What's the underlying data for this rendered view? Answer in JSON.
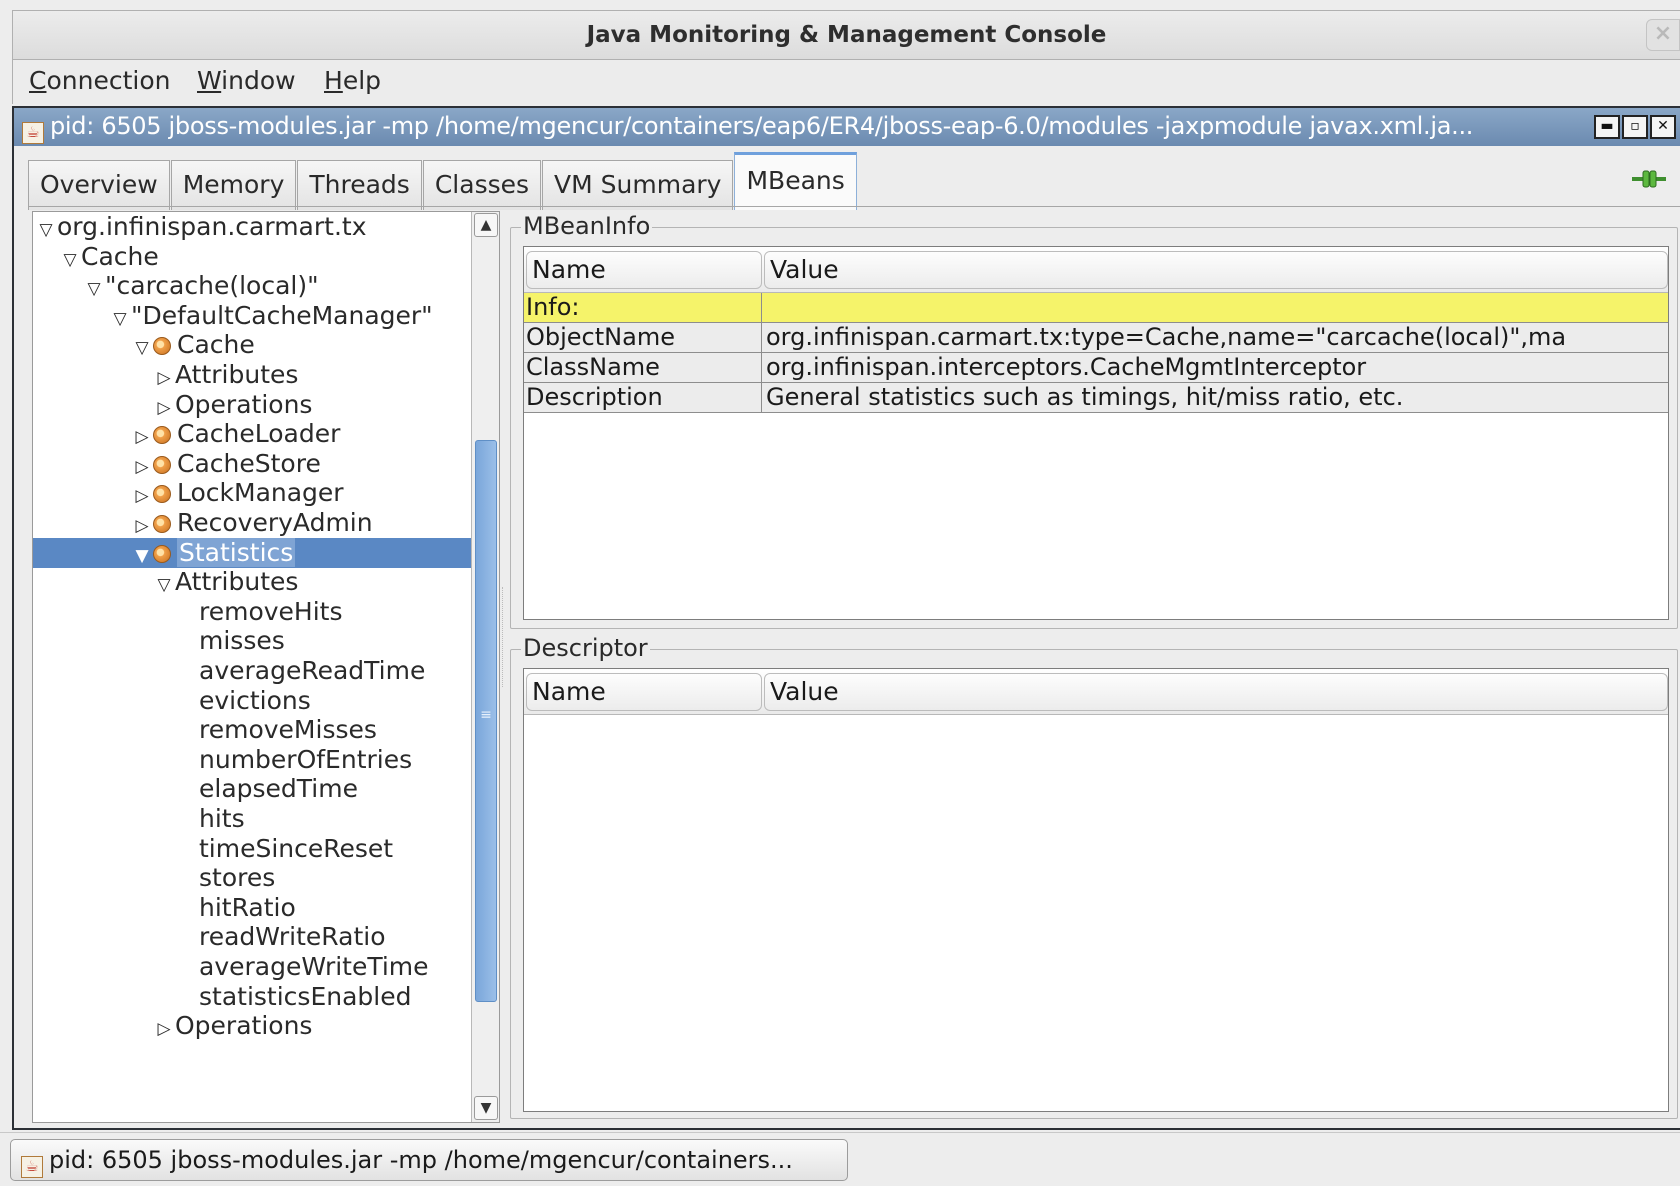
{
  "app": {
    "title": "Java Monitoring & Management Console",
    "close_glyph": "×"
  },
  "menubar": {
    "items": [
      {
        "mnemonic": "C",
        "rest": "onnection"
      },
      {
        "mnemonic": "W",
        "rest": "indow"
      },
      {
        "mnemonic": "H",
        "rest": "elp"
      }
    ]
  },
  "internal_frame": {
    "title": "pid: 6505 jboss-modules.jar -mp /home/mgencur/containers/eap6/ER4/jboss-eap-6.0/modules -jaxpmodule javax.xml.ja...",
    "icon": "java-icon",
    "buttons": {
      "minimize": "▬",
      "restore": "▫",
      "close": "✕"
    }
  },
  "tabs": [
    "Overview",
    "Memory",
    "Threads",
    "Classes",
    "VM Summary",
    "MBeans"
  ],
  "active_tab": "MBeans",
  "tree": {
    "selected": "Statistics",
    "toggle_glyphs": {
      "expanded": "▽",
      "collapsed": "▷",
      "selected_expanded": "▼"
    },
    "items": [
      {
        "label": "org.infinispan.carmart.tx",
        "state": "expanded"
      },
      {
        "label": "Cache",
        "state": "expanded"
      },
      {
        "label": "\"carcache(local)\"",
        "state": "expanded"
      },
      {
        "label": "\"DefaultCacheManager\"",
        "state": "expanded"
      },
      {
        "label": "Cache",
        "state": "expanded",
        "icon": "bean-icon"
      },
      {
        "label": "Attributes",
        "state": "collapsed"
      },
      {
        "label": "Operations",
        "state": "collapsed"
      },
      {
        "label": "CacheLoader",
        "state": "collapsed",
        "icon": "bean-icon"
      },
      {
        "label": "CacheStore",
        "state": "collapsed",
        "icon": "bean-icon"
      },
      {
        "label": "LockManager",
        "state": "collapsed",
        "icon": "bean-icon"
      },
      {
        "label": "RecoveryAdmin",
        "state": "collapsed",
        "icon": "bean-icon"
      },
      {
        "label": "Statistics",
        "state": "selected_expanded",
        "icon": "bean-icon"
      },
      {
        "label": "Attributes",
        "state": "expanded"
      },
      {
        "label": "removeHits",
        "state": "leaf"
      },
      {
        "label": "misses",
        "state": "leaf"
      },
      {
        "label": "averageReadTime",
        "state": "leaf"
      },
      {
        "label": "evictions",
        "state": "leaf"
      },
      {
        "label": "removeMisses",
        "state": "leaf"
      },
      {
        "label": "numberOfEntries",
        "state": "leaf"
      },
      {
        "label": "elapsedTime",
        "state": "leaf"
      },
      {
        "label": "hits",
        "state": "leaf"
      },
      {
        "label": "timeSinceReset",
        "state": "leaf"
      },
      {
        "label": "stores",
        "state": "leaf"
      },
      {
        "label": "hitRatio",
        "state": "leaf"
      },
      {
        "label": "readWriteRatio",
        "state": "leaf"
      },
      {
        "label": "averageWriteTime",
        "state": "leaf"
      },
      {
        "label": "statisticsEnabled",
        "state": "leaf"
      },
      {
        "label": "Operations",
        "state": "collapsed"
      }
    ],
    "scroll": {
      "up": "▲",
      "down": "▼",
      "grip": "≡"
    }
  },
  "mbean_info": {
    "title": "MBeanInfo",
    "columns": [
      "Name",
      "Value"
    ],
    "rows": [
      {
        "name": "Info:",
        "value": ""
      },
      {
        "name": "ObjectName",
        "value": "org.infinispan.carmart.tx:type=Cache,name=\"carcache(local)\",ma..."
      },
      {
        "name": "ClassName",
        "value": "org.infinispan.interceptors.CacheMgmtInterceptor"
      },
      {
        "name": "Description",
        "value": "General statistics such as timings, hit/miss ratio, etc."
      }
    ]
  },
  "descriptor": {
    "title": "Descriptor",
    "columns": [
      "Name",
      "Value"
    ]
  },
  "taskbar": {
    "label": "pid: 6505 jboss-modules.jar -mp /home/mgencur/containers..."
  },
  "colors": {
    "frame_title": "#7896bb",
    "selection": "#5a88c4",
    "info_row": "#f5f36a",
    "scroll_thumb": "#7aa6da"
  }
}
